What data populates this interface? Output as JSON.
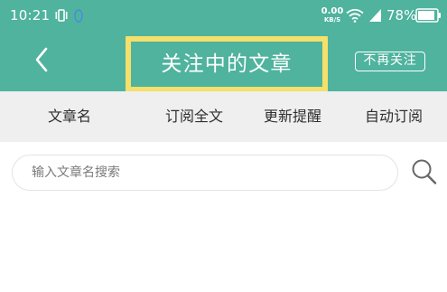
{
  "status_bar": {
    "time": "10:21",
    "net_speed_value": "0.00",
    "net_speed_unit": "KB/S",
    "battery": "78%",
    "icons": [
      "vibrate-icon",
      "ring-icon",
      "wifi-icon",
      "signal-icon",
      "battery-icon"
    ]
  },
  "header": {
    "back_icon": "chevron-left-icon",
    "title": "关注中的文章",
    "unfollow_label": "不再关注"
  },
  "columns": [
    "文章名",
    "订阅全文",
    "更新提醒",
    "自动订阅"
  ],
  "search": {
    "value": "",
    "placeholder": "输入文章名搜索",
    "icon": "search-icon"
  },
  "colors": {
    "accent": "#4fb39e",
    "highlight_border": "#f4e06a",
    "header_row_bg": "#efefef"
  }
}
